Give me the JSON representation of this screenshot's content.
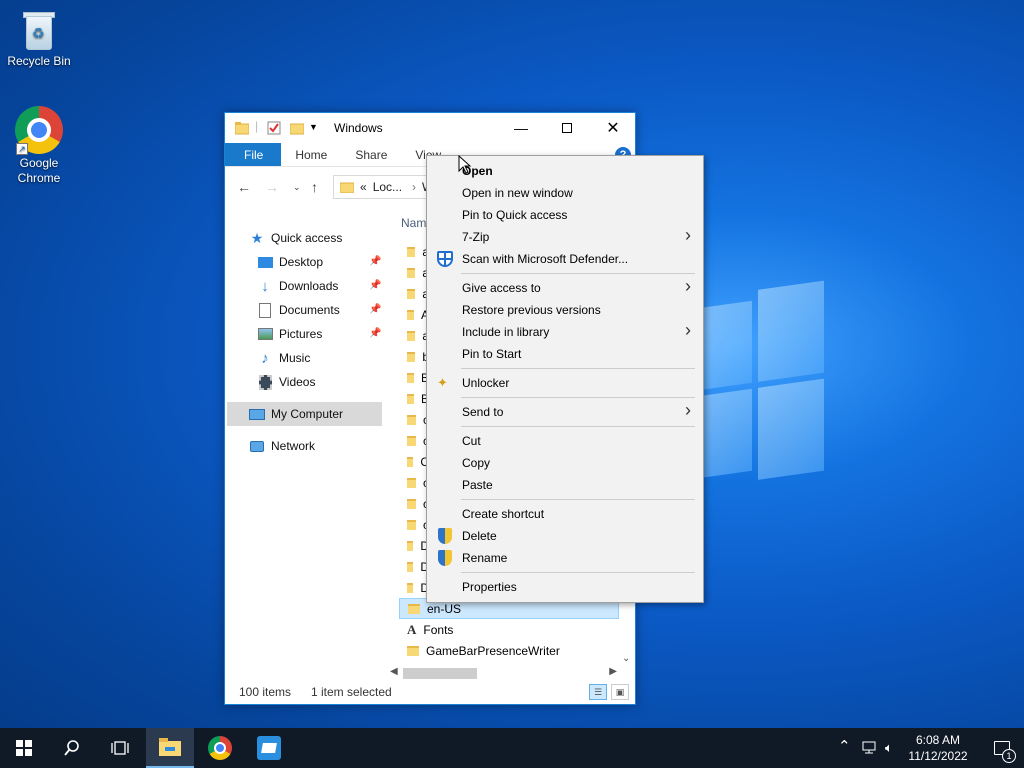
{
  "desktop": {
    "icons": [
      {
        "label": "Recycle Bin",
        "icon": "recycle-bin-icon"
      },
      {
        "label": "Google Chrome",
        "icon": "chrome-icon"
      }
    ]
  },
  "explorer": {
    "title": "Windows",
    "ribbon_tabs": [
      "File",
      "Home",
      "Share",
      "View"
    ],
    "address": {
      "prefix": "«",
      "crumb": "Loc...",
      "crumb2": "W"
    },
    "nav": {
      "quick_access": "Quick access",
      "items": [
        "Desktop",
        "Downloads",
        "Documents",
        "Pictures",
        "Music",
        "Videos"
      ],
      "my_computer": "My Computer",
      "network": "Network"
    },
    "column_header": "Nam",
    "folder_initials": [
      "a",
      "a",
      "a",
      "A",
      "a",
      "b",
      "B",
      "B",
      "c",
      "c",
      "C",
      "c",
      "c",
      "c",
      "D",
      "D",
      "D"
    ],
    "files": [
      {
        "name": "en-US",
        "selected": true,
        "type": "folder"
      },
      {
        "name": "Fonts",
        "selected": false,
        "type": "fonts"
      },
      {
        "name": "GameBarPresenceWriter",
        "selected": false,
        "type": "folder"
      }
    ],
    "status": {
      "count": "100 items",
      "selection": "1 item selected"
    }
  },
  "context_menu": {
    "groups": [
      [
        {
          "label": "Open",
          "bold": true
        },
        {
          "label": "Open in new window"
        },
        {
          "label": "Pin to Quick access"
        },
        {
          "label": "7-Zip",
          "submenu": true
        },
        {
          "label": "Scan with Microsoft Defender...",
          "icon": "defender-icon"
        }
      ],
      [
        {
          "label": "Give access to",
          "submenu": true
        },
        {
          "label": "Restore previous versions"
        },
        {
          "label": "Include in library",
          "submenu": true
        },
        {
          "label": "Pin to Start"
        }
      ],
      [
        {
          "label": "Unlocker",
          "icon": "unlocker-icon"
        }
      ],
      [
        {
          "label": "Send to",
          "submenu": true
        }
      ],
      [
        {
          "label": "Cut"
        },
        {
          "label": "Copy"
        },
        {
          "label": "Paste"
        }
      ],
      [
        {
          "label": "Create shortcut"
        },
        {
          "label": "Delete",
          "icon": "uac-shield-icon"
        },
        {
          "label": "Rename",
          "icon": "uac-shield-icon"
        }
      ],
      [
        {
          "label": "Properties"
        }
      ]
    ]
  },
  "taskbar": {
    "time": "6:08 AM",
    "date": "11/12/2022",
    "notification_count": "1"
  },
  "colors": {
    "accent": "#1979ca",
    "selection": "#cce8ff",
    "taskbar": "#101a27"
  }
}
